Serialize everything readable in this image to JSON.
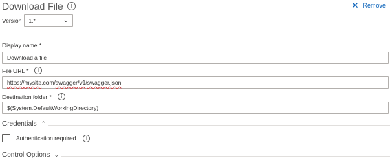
{
  "header": {
    "title": "Download File",
    "remove_label": "Remove",
    "remove_icon": "✕"
  },
  "version": {
    "label": "Version",
    "selected": "1.*"
  },
  "display_name": {
    "label": "Display name *",
    "value": "Download a file"
  },
  "file_url": {
    "label": "File URL *",
    "value_parts": [
      "https://",
      "mysite",
      ".com/",
      "swagger",
      "/",
      "v1",
      "/",
      "swagger.json"
    ]
  },
  "destination": {
    "label": "Destination folder *",
    "value": "$(System.DefaultWorkingDirectory)"
  },
  "credentials": {
    "title": "Credentials",
    "expanded": true,
    "auth_label": "Authentication required",
    "auth_checked": false
  },
  "control_options": {
    "title": "Control Options",
    "expanded": false
  },
  "icons": {
    "info": "i",
    "caret_up": "⌃",
    "caret_down": "⌄",
    "chevron_down": "⌄"
  },
  "colors": {
    "link": "#0b63ba",
    "border": "#b3b0ad",
    "spellcheck": "#d13438"
  }
}
